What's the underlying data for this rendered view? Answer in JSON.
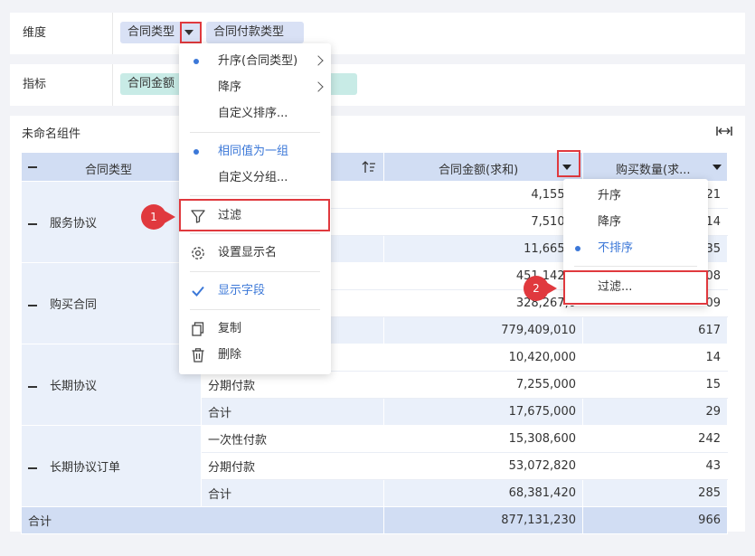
{
  "dimension": {
    "label": "维度",
    "chips": [
      "合同类型",
      "合同付款类型"
    ]
  },
  "indicator": {
    "label": "指标",
    "chips": [
      "合同金额",
      ")"
    ]
  },
  "component": {
    "title": "未命名组件"
  },
  "table": {
    "headers": [
      "合同类型",
      "",
      "合同金额(求和)",
      "购买数量(求..."
    ],
    "groups": [
      {
        "name": "服务协议",
        "rows": [
          {
            "sub": "",
            "amount": "4,155,8",
            "qty": "21"
          },
          {
            "sub": "",
            "amount": "7,510,0",
            "qty": "14"
          }
        ],
        "subtotal": {
          "label": "",
          "amount": "11,665,8",
          "qty": "35"
        }
      },
      {
        "name": "购买合同",
        "rows": [
          {
            "sub": "",
            "amount": "451,142,0",
            "qty": "08"
          },
          {
            "sub": "",
            "amount": "328,267,0",
            "qty": "09"
          }
        ],
        "subtotal": {
          "label": "",
          "amount": "779,409,010",
          "qty": "617"
        }
      },
      {
        "name": "长期协议",
        "rows": [
          {
            "sub": "",
            "amount": "10,420,000",
            "qty": "14"
          },
          {
            "sub": "分期付款",
            "amount": "7,255,000",
            "qty": "15"
          }
        ],
        "subtotal": {
          "label": "合计",
          "amount": "17,675,000",
          "qty": "29"
        }
      },
      {
        "name": "长期协议订单",
        "rows": [
          {
            "sub": "一次性付款",
            "amount": "15,308,600",
            "qty": "242"
          },
          {
            "sub": "分期付款",
            "amount": "53,072,820",
            "qty": "43"
          }
        ],
        "subtotal": {
          "label": "合计",
          "amount": "68,381,420",
          "qty": "285"
        }
      }
    ],
    "total": {
      "label": "合计",
      "amount": "877,131,230",
      "qty": "966"
    }
  },
  "menu1": {
    "items": {
      "asc": "升序(合同类型)",
      "desc": "降序",
      "custom_sort": "自定义排序...",
      "same_group": "相同值为一组",
      "custom_group": "自定义分组...",
      "filter": "过滤",
      "display_name": "设置显示名",
      "show_field": "显示字段",
      "copy": "复制",
      "delete": "删除"
    }
  },
  "menu2": {
    "items": {
      "asc": "升序",
      "desc": "降序",
      "none": "不排序",
      "filter": "过滤..."
    }
  },
  "badges": [
    "1",
    "2"
  ],
  "colors": {
    "accent": "#3c78d8",
    "highlight": "#e0393e",
    "header_bg": "#d1ddf3",
    "chip_blue": "#d9e1f5",
    "chip_teal": "#c8ebe6"
  }
}
